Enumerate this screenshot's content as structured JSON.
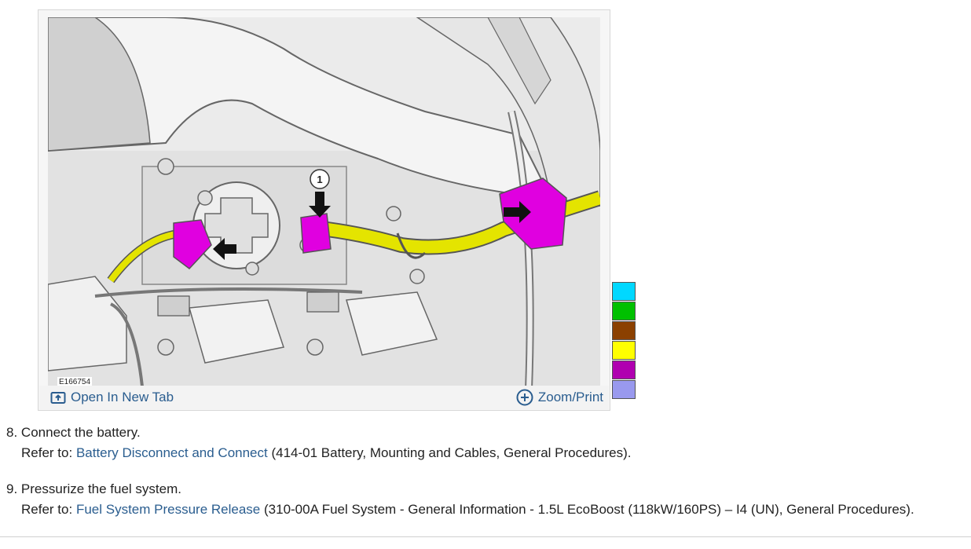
{
  "figure": {
    "id_label": "E166754",
    "callout_number": "1",
    "open_tab_label": "Open In New Tab",
    "zoom_label": "Zoom/Print"
  },
  "palette": {
    "colors": [
      "#00d8ff",
      "#00c000",
      "#8b4000",
      "#ffff00",
      "#b000b0",
      "#9999ee"
    ]
  },
  "steps": [
    {
      "number": "8.",
      "text": "Connect the battery.",
      "refer_prefix": "Refer to:",
      "link_text": "Battery Disconnect and Connect",
      "suffix": "(414-01 Battery, Mounting and Cables, General Procedures)."
    },
    {
      "number": "9.",
      "text": "Pressurize the fuel system.",
      "refer_prefix": "Refer to:",
      "link_text": "Fuel System Pressure Release",
      "suffix": "(310-00A Fuel System - General Information - 1.5L EcoBoost (118kW/160PS) – I4 (UN), General Procedures)."
    }
  ]
}
